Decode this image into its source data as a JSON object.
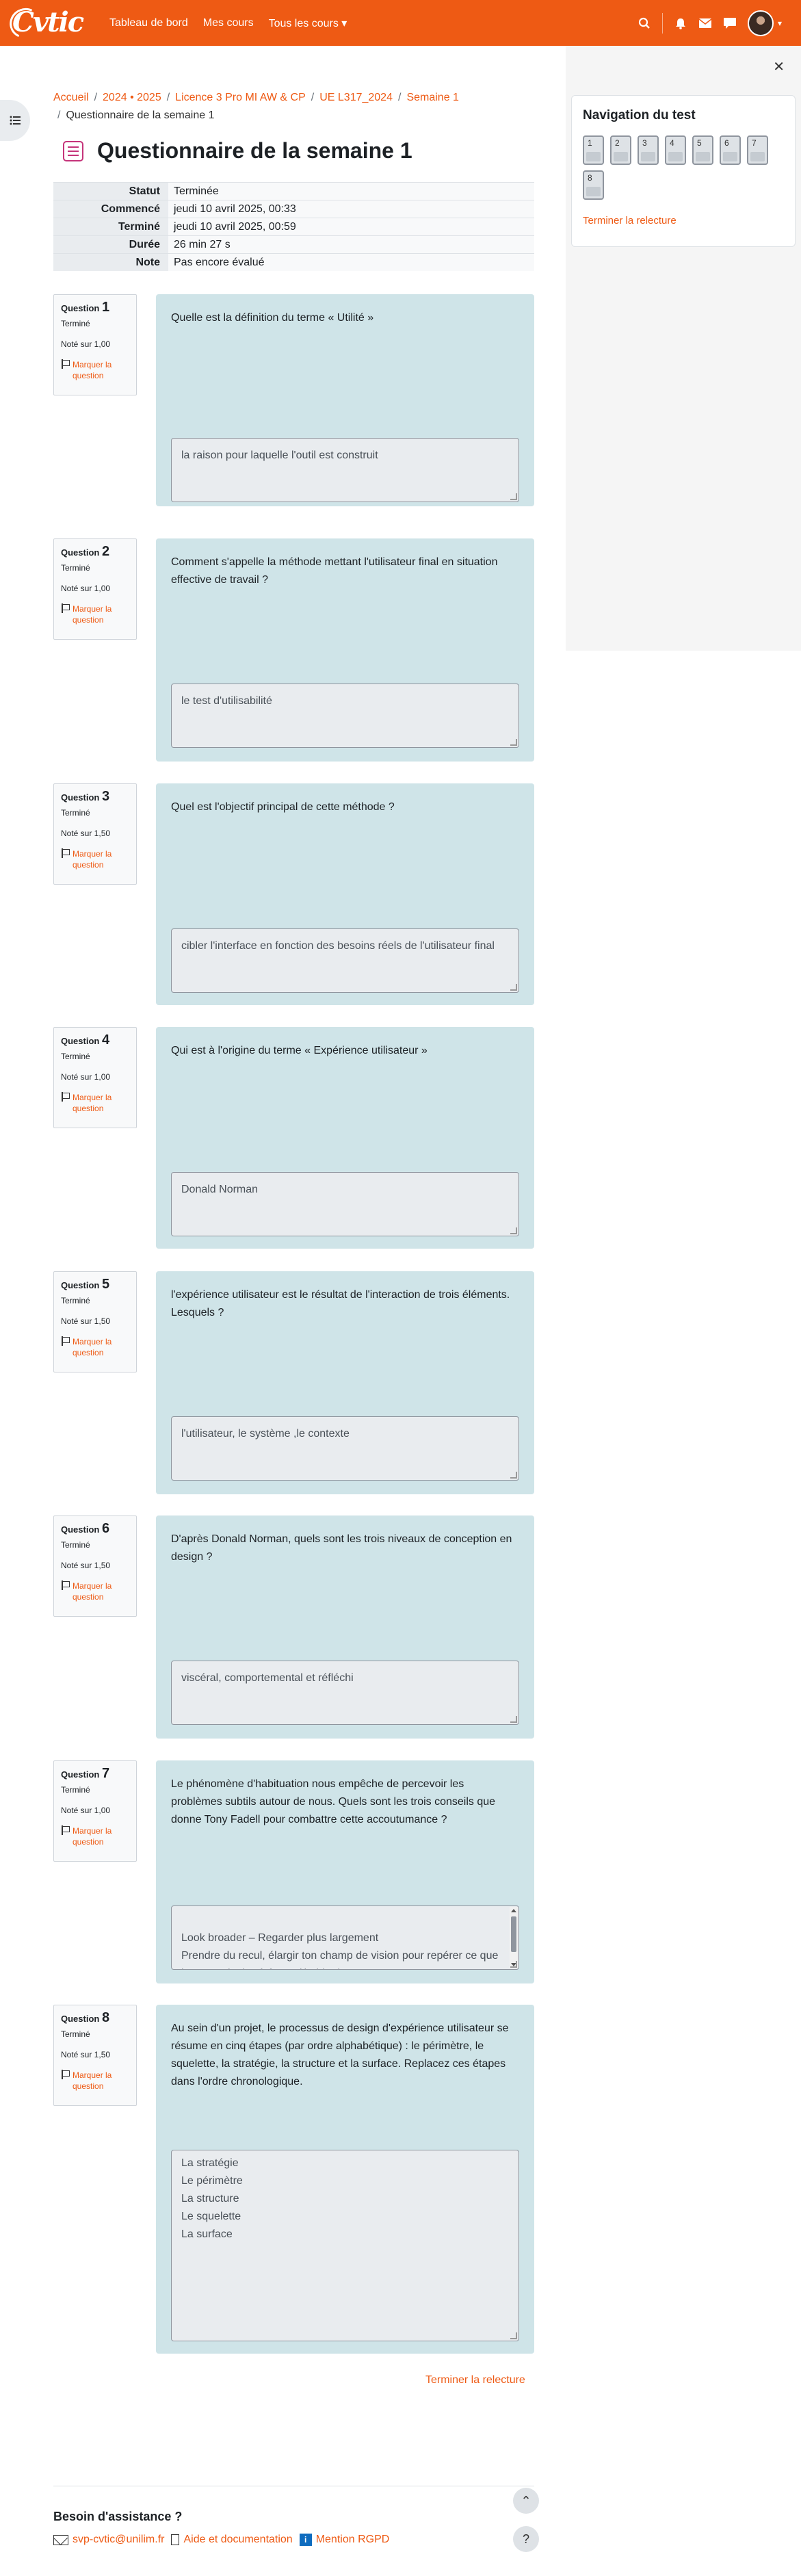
{
  "navbar": {
    "logo_text": "Cvtic",
    "links": [
      "Tableau de bord",
      "Mes cours",
      "Tous les cours ▾"
    ],
    "icons": [
      "search-icon",
      "bell-icon",
      "mail-icon",
      "message-icon",
      "avatar"
    ]
  },
  "breadcrumb": {
    "items": [
      "Accueil",
      "2024 • 2025",
      "Licence 3 Pro MI AW & CP",
      "UE L317_2024",
      "Semaine 1"
    ],
    "current": "Questionnaire de la semaine 1"
  },
  "page_title": "Questionnaire de la semaine 1",
  "summary": [
    {
      "label": "Statut",
      "value": "Terminée"
    },
    {
      "label": "Commencé",
      "value": "jeudi 10 avril 2025, 00:33"
    },
    {
      "label": "Terminé",
      "value": "jeudi 10 avril 2025, 00:59"
    },
    {
      "label": "Durée",
      "value": "26 min 27 s"
    },
    {
      "label": "Note",
      "value": "Pas encore évalué"
    }
  ],
  "question_label": "Question",
  "flag_label": "Marquer la question",
  "questions": [
    {
      "num": "1",
      "state": "Terminé",
      "grade": "Noté sur 1,00",
      "text": "Quelle est la définition du terme « Utilité »",
      "answer": "la raison pour laquelle l'outil est construit"
    },
    {
      "num": "2",
      "state": "Terminé",
      "grade": "Noté sur 1,00",
      "text": "Comment s'appelle la méthode mettant l'utilisateur final en situation effective de travail ?",
      "answer": "le test d'utilisabilité"
    },
    {
      "num": "3",
      "state": "Terminé",
      "grade": "Noté sur 1,50",
      "text": "Quel est l'objectif principal de cette méthode ?",
      "answer": "cibler l'interface en fonction des besoins réels de l'utilisateur final"
    },
    {
      "num": "4",
      "state": "Terminé",
      "grade": "Noté sur 1,00",
      "text": "Qui est à l'origine du terme « Expérience utilisateur »",
      "answer": "Donald Norman"
    },
    {
      "num": "5",
      "state": "Terminé",
      "grade": "Noté sur 1,50",
      "text": "l'expérience utilisateur est le résultat de l'interaction de trois éléments. Lesquels ?",
      "answer": "l'utilisateur, le système ,le contexte"
    },
    {
      "num": "6",
      "state": "Terminé",
      "grade": "Noté sur 1,50",
      "text": "D'après Donald Norman, quels sont les trois niveaux de conception en design ?",
      "answer": "viscéral, comportemental et réfléchi"
    },
    {
      "num": "7",
      "state": "Terminé",
      "grade": "Noté sur 1,00",
      "text": "Le phénomène d'habituation nous empêche de percevoir les problèmes subtils autour de nous. Quels sont les trois conseils que donne Tony Fadell pour combattre cette accoutumance ?",
      "answer": "Look broader – Regarder plus largement\n Prendre du recul, élargir ton champ de vision pour repérer ce que l'on ne voit plus à force d'habitude."
    },
    {
      "num": "8",
      "state": "Terminé",
      "grade": "Noté sur 1,50",
      "text": "Au sein d'un projet, le processus de design d'expérience utilisateur se résume en cinq étapes (par ordre alphabétique) : le périmètre, le squelette, la stratégie, la structure et la surface. Replacez ces étapes dans l'ordre chronologique.",
      "answer": "La stratégie\nLe périmètre\nLa structure\nLe squelette\nLa surface"
    }
  ],
  "quiz_nav": {
    "title": "Navigation du test",
    "buttons": [
      "1",
      "2",
      "3",
      "4",
      "5",
      "6",
      "7",
      "8"
    ],
    "finish_review": "Terminer la relecture"
  },
  "finish_review_bottom": "Terminer la relecture",
  "footer": {
    "title": "Besoin d'assistance ?",
    "email": "svp-cvtic@unilim.fr",
    "help": "Aide et documentation",
    "rgpd": "Mention RGPD",
    "info_glyph": "i",
    "scroll_up": "⌃",
    "help_btn": "?"
  },
  "colors": {
    "brand": "#ee5a14",
    "question_bg": "#cfe4e8"
  }
}
